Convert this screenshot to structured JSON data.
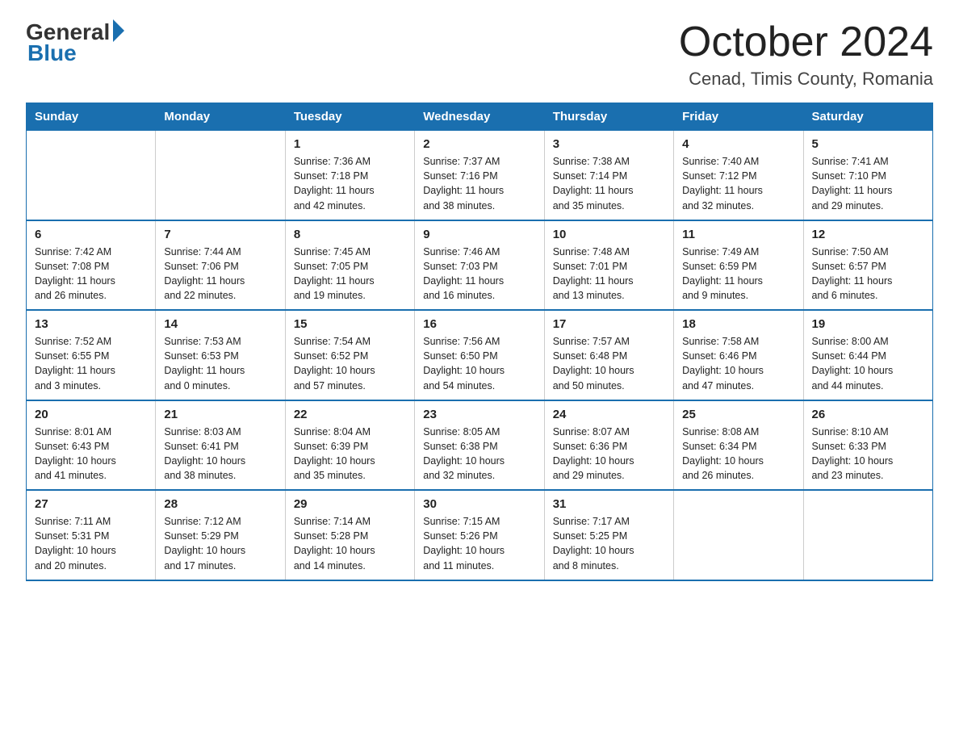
{
  "header": {
    "logo_general": "General",
    "logo_blue": "Blue",
    "month_year": "October 2024",
    "location": "Cenad, Timis County, Romania"
  },
  "days_of_week": [
    "Sunday",
    "Monday",
    "Tuesday",
    "Wednesday",
    "Thursday",
    "Friday",
    "Saturday"
  ],
  "weeks": [
    [
      {
        "num": "",
        "info": ""
      },
      {
        "num": "",
        "info": ""
      },
      {
        "num": "1",
        "info": "Sunrise: 7:36 AM\nSunset: 7:18 PM\nDaylight: 11 hours\nand 42 minutes."
      },
      {
        "num": "2",
        "info": "Sunrise: 7:37 AM\nSunset: 7:16 PM\nDaylight: 11 hours\nand 38 minutes."
      },
      {
        "num": "3",
        "info": "Sunrise: 7:38 AM\nSunset: 7:14 PM\nDaylight: 11 hours\nand 35 minutes."
      },
      {
        "num": "4",
        "info": "Sunrise: 7:40 AM\nSunset: 7:12 PM\nDaylight: 11 hours\nand 32 minutes."
      },
      {
        "num": "5",
        "info": "Sunrise: 7:41 AM\nSunset: 7:10 PM\nDaylight: 11 hours\nand 29 minutes."
      }
    ],
    [
      {
        "num": "6",
        "info": "Sunrise: 7:42 AM\nSunset: 7:08 PM\nDaylight: 11 hours\nand 26 minutes."
      },
      {
        "num": "7",
        "info": "Sunrise: 7:44 AM\nSunset: 7:06 PM\nDaylight: 11 hours\nand 22 minutes."
      },
      {
        "num": "8",
        "info": "Sunrise: 7:45 AM\nSunset: 7:05 PM\nDaylight: 11 hours\nand 19 minutes."
      },
      {
        "num": "9",
        "info": "Sunrise: 7:46 AM\nSunset: 7:03 PM\nDaylight: 11 hours\nand 16 minutes."
      },
      {
        "num": "10",
        "info": "Sunrise: 7:48 AM\nSunset: 7:01 PM\nDaylight: 11 hours\nand 13 minutes."
      },
      {
        "num": "11",
        "info": "Sunrise: 7:49 AM\nSunset: 6:59 PM\nDaylight: 11 hours\nand 9 minutes."
      },
      {
        "num": "12",
        "info": "Sunrise: 7:50 AM\nSunset: 6:57 PM\nDaylight: 11 hours\nand 6 minutes."
      }
    ],
    [
      {
        "num": "13",
        "info": "Sunrise: 7:52 AM\nSunset: 6:55 PM\nDaylight: 11 hours\nand 3 minutes."
      },
      {
        "num": "14",
        "info": "Sunrise: 7:53 AM\nSunset: 6:53 PM\nDaylight: 11 hours\nand 0 minutes."
      },
      {
        "num": "15",
        "info": "Sunrise: 7:54 AM\nSunset: 6:52 PM\nDaylight: 10 hours\nand 57 minutes."
      },
      {
        "num": "16",
        "info": "Sunrise: 7:56 AM\nSunset: 6:50 PM\nDaylight: 10 hours\nand 54 minutes."
      },
      {
        "num": "17",
        "info": "Sunrise: 7:57 AM\nSunset: 6:48 PM\nDaylight: 10 hours\nand 50 minutes."
      },
      {
        "num": "18",
        "info": "Sunrise: 7:58 AM\nSunset: 6:46 PM\nDaylight: 10 hours\nand 47 minutes."
      },
      {
        "num": "19",
        "info": "Sunrise: 8:00 AM\nSunset: 6:44 PM\nDaylight: 10 hours\nand 44 minutes."
      }
    ],
    [
      {
        "num": "20",
        "info": "Sunrise: 8:01 AM\nSunset: 6:43 PM\nDaylight: 10 hours\nand 41 minutes."
      },
      {
        "num": "21",
        "info": "Sunrise: 8:03 AM\nSunset: 6:41 PM\nDaylight: 10 hours\nand 38 minutes."
      },
      {
        "num": "22",
        "info": "Sunrise: 8:04 AM\nSunset: 6:39 PM\nDaylight: 10 hours\nand 35 minutes."
      },
      {
        "num": "23",
        "info": "Sunrise: 8:05 AM\nSunset: 6:38 PM\nDaylight: 10 hours\nand 32 minutes."
      },
      {
        "num": "24",
        "info": "Sunrise: 8:07 AM\nSunset: 6:36 PM\nDaylight: 10 hours\nand 29 minutes."
      },
      {
        "num": "25",
        "info": "Sunrise: 8:08 AM\nSunset: 6:34 PM\nDaylight: 10 hours\nand 26 minutes."
      },
      {
        "num": "26",
        "info": "Sunrise: 8:10 AM\nSunset: 6:33 PM\nDaylight: 10 hours\nand 23 minutes."
      }
    ],
    [
      {
        "num": "27",
        "info": "Sunrise: 7:11 AM\nSunset: 5:31 PM\nDaylight: 10 hours\nand 20 minutes."
      },
      {
        "num": "28",
        "info": "Sunrise: 7:12 AM\nSunset: 5:29 PM\nDaylight: 10 hours\nand 17 minutes."
      },
      {
        "num": "29",
        "info": "Sunrise: 7:14 AM\nSunset: 5:28 PM\nDaylight: 10 hours\nand 14 minutes."
      },
      {
        "num": "30",
        "info": "Sunrise: 7:15 AM\nSunset: 5:26 PM\nDaylight: 10 hours\nand 11 minutes."
      },
      {
        "num": "31",
        "info": "Sunrise: 7:17 AM\nSunset: 5:25 PM\nDaylight: 10 hours\nand 8 minutes."
      },
      {
        "num": "",
        "info": ""
      },
      {
        "num": "",
        "info": ""
      }
    ]
  ]
}
